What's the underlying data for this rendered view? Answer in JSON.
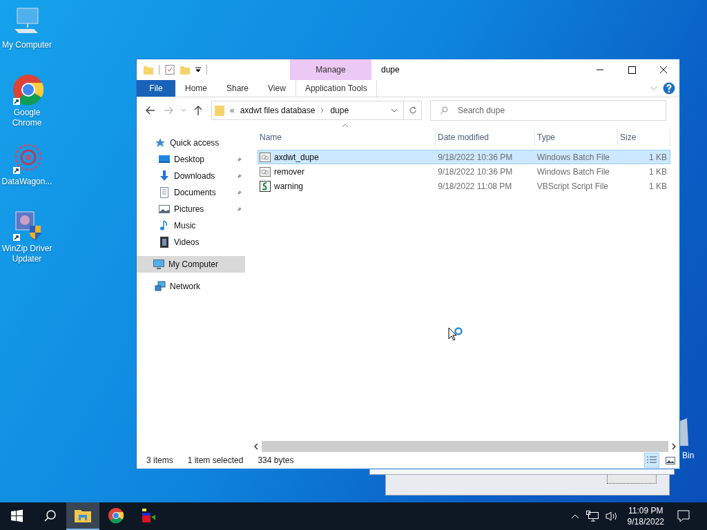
{
  "desktop": {
    "icons": [
      {
        "label": "My Computer",
        "kind": "computer",
        "shortcut": false
      },
      {
        "label": "Google Chrome",
        "kind": "chrome",
        "shortcut": true
      },
      {
        "label": "DataWagon...",
        "kind": "mandala",
        "shortcut": true
      },
      {
        "label": "WinZip Driver Updater",
        "kind": "winzip",
        "shortcut": true
      }
    ],
    "recycle_label": "Bin"
  },
  "window": {
    "title": "dupe",
    "ribbon": {
      "contextual_group": "Manage",
      "tabs": [
        {
          "label": "File",
          "kind": "file"
        },
        {
          "label": "Home",
          "kind": "plain"
        },
        {
          "label": "Share",
          "kind": "plain"
        },
        {
          "label": "View",
          "kind": "plain"
        },
        {
          "label": "Application Tools",
          "kind": "contextual"
        }
      ]
    },
    "address": {
      "prefix": "«",
      "path": [
        "axdwt files database",
        "dupe"
      ]
    },
    "search": {
      "placeholder": "Search dupe"
    },
    "sidebar": [
      {
        "label": "Quick access",
        "kind": "star",
        "selected": false,
        "children": [
          {
            "label": "Desktop",
            "kind": "desktop",
            "pinned": true
          },
          {
            "label": "Downloads",
            "kind": "download",
            "pinned": true
          },
          {
            "label": "Documents",
            "kind": "document",
            "pinned": true
          },
          {
            "label": "Pictures",
            "kind": "pictures",
            "pinned": true
          },
          {
            "label": "Music",
            "kind": "music",
            "pinned": false
          },
          {
            "label": "Videos",
            "kind": "videos",
            "pinned": false
          }
        ]
      },
      {
        "label": "My Computer",
        "kind": "computer",
        "selected": true
      },
      {
        "label": "Network",
        "kind": "network",
        "selected": false
      }
    ],
    "columns": [
      "Name",
      "Date modified",
      "Type",
      "Size"
    ],
    "rows": [
      {
        "name": "axdwt_dupe",
        "date": "9/18/2022 10:36 PM",
        "type": "Windows Batch File",
        "size": "1 KB",
        "kind": "batch",
        "selected": true
      },
      {
        "name": "remover",
        "date": "9/18/2022 10:36 PM",
        "type": "Windows Batch File",
        "size": "1 KB",
        "kind": "batch",
        "selected": false
      },
      {
        "name": "warning",
        "date": "9/18/2022 11:08 PM",
        "type": "VBScript Script File",
        "size": "1 KB",
        "kind": "script",
        "selected": false
      }
    ],
    "status": {
      "count": "3 items",
      "selection": "1 item selected",
      "bytes": "334 bytes"
    },
    "views": [
      {
        "kind": "details",
        "selected": true
      },
      {
        "kind": "tiles",
        "selected": false
      }
    ]
  },
  "taskbar": {
    "apps": [
      {
        "kind": "explorer",
        "active": true
      },
      {
        "kind": "chrome",
        "active": false
      },
      {
        "kind": "app",
        "active": false
      }
    ],
    "time": "11:09 PM",
    "date": "9/18/2022"
  }
}
